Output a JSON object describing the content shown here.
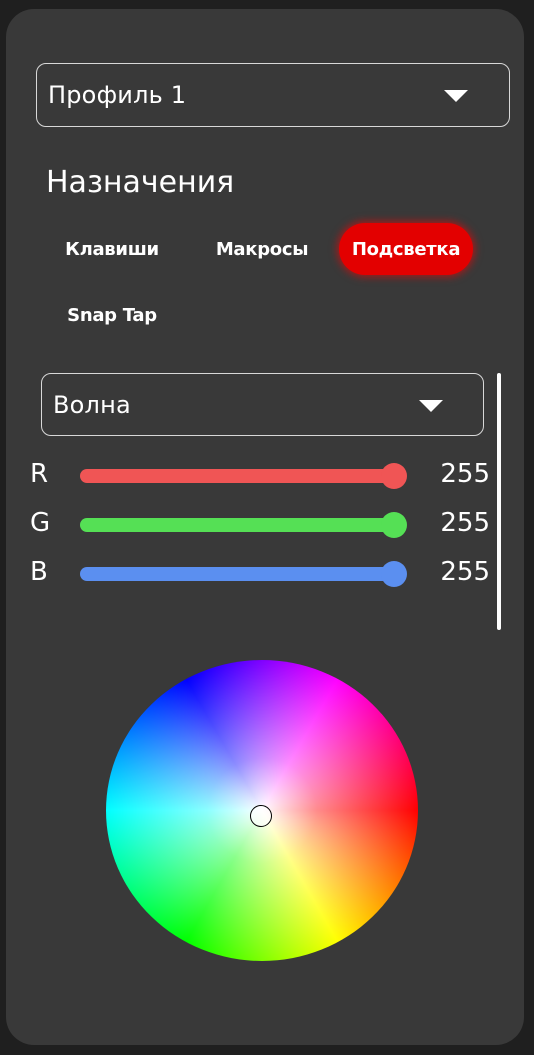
{
  "profile_select": {
    "value": "Профиль 1"
  },
  "assignments": {
    "heading": "Назначения",
    "tabs": [
      {
        "label": "Клавиши",
        "active": false
      },
      {
        "label": "Макросы",
        "active": false
      },
      {
        "label": "Подсветка",
        "active": true
      },
      {
        "label": "Snap Tap",
        "active": false
      }
    ]
  },
  "lighting": {
    "effect_select": {
      "value": "Волна"
    },
    "sliders": [
      {
        "label": "R",
        "value": "255",
        "level": 1.0,
        "color": "#f05555"
      },
      {
        "label": "G",
        "value": "255",
        "level": 1.0,
        "color": "#55e055"
      },
      {
        "label": "B",
        "value": "255",
        "level": 1.0,
        "color": "#5b8ff0"
      }
    ]
  },
  "colors": {
    "panel": "#393939",
    "background": "#1f1f1f",
    "active_tab": "#e30000"
  },
  "icons": {
    "dropdown": "chevron-down-icon"
  }
}
